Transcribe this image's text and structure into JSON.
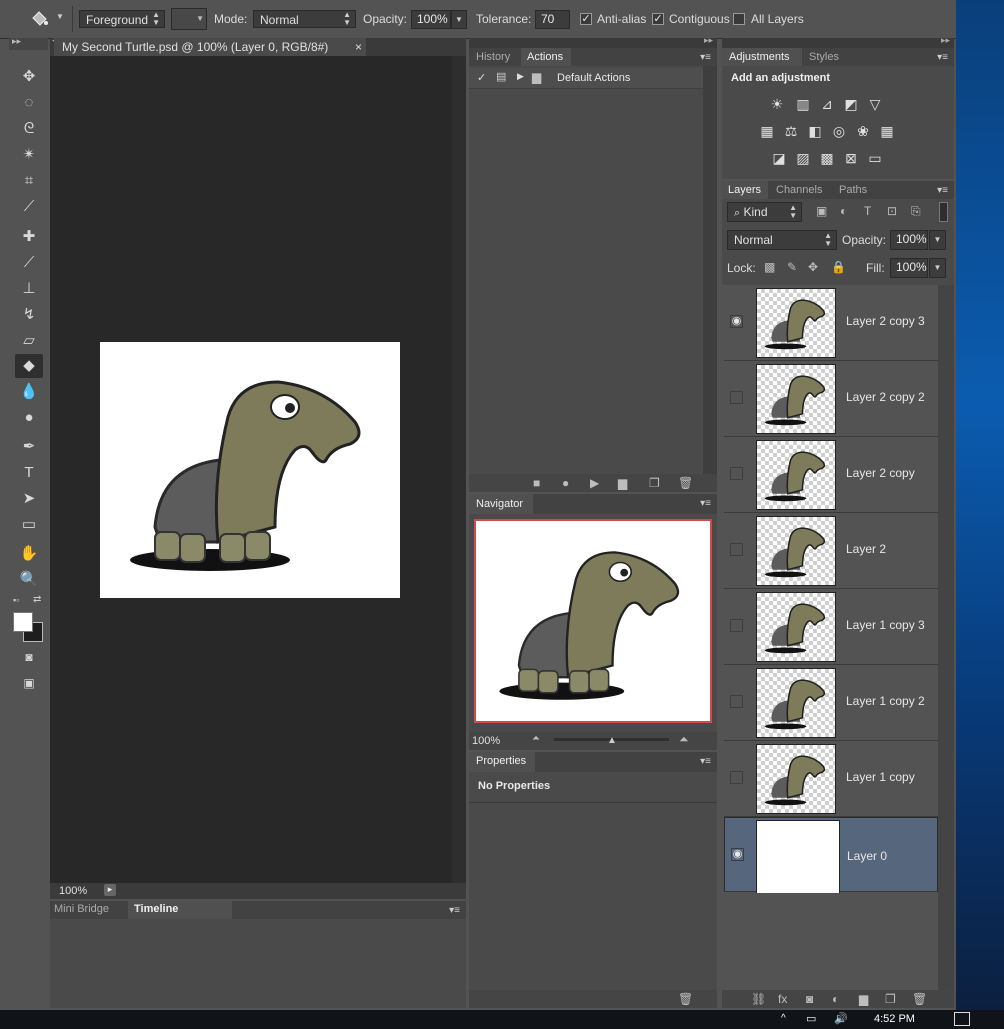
{
  "options_bar": {
    "fill_source": "Foreground",
    "mode_label": "Mode:",
    "mode_value": "Normal",
    "opacity_label": "Opacity:",
    "opacity_value": "100%",
    "tolerance_label": "Tolerance:",
    "tolerance_value": "70",
    "antialias_label": "Anti-alias",
    "antialias_checked": true,
    "contiguous_label": "Contiguous",
    "contiguous_checked": true,
    "all_layers_label": "All Layers",
    "all_layers_checked": false
  },
  "document": {
    "tab_title": "My Second Turtle.psd @ 100% (Layer 0, RGB/8#)",
    "zoom": "100%"
  },
  "bottom_panel": {
    "tabs": [
      "Mini Bridge",
      "Timeline"
    ]
  },
  "actions_panel": {
    "tabs": [
      "History",
      "Actions"
    ],
    "items": [
      {
        "label": "Default Actions"
      }
    ]
  },
  "navigator_panel": {
    "title": "Navigator",
    "zoom": "100%"
  },
  "properties_panel": {
    "title": "Properties",
    "message": "No Properties"
  },
  "adjustments_panel": {
    "tabs": [
      "Adjustments",
      "Styles"
    ],
    "heading": "Add an adjustment"
  },
  "layers_panel": {
    "tabs": [
      "Layers",
      "Channels",
      "Paths"
    ],
    "filter_kind": "Kind",
    "blend_mode": "Normal",
    "opacity_label": "Opacity:",
    "opacity_value": "100%",
    "lock_label": "Lock:",
    "fill_label": "Fill:",
    "fill_value": "100%",
    "layers": [
      {
        "name": "Layer 2 copy 3",
        "visible": true
      },
      {
        "name": "Layer 2 copy 2",
        "visible": false
      },
      {
        "name": "Layer 2 copy",
        "visible": false
      },
      {
        "name": "Layer 2",
        "visible": false
      },
      {
        "name": "Layer 1 copy 3",
        "visible": false
      },
      {
        "name": "Layer 1 copy 2",
        "visible": false
      },
      {
        "name": "Layer 1 copy",
        "visible": false
      },
      {
        "name": "Layer 0",
        "visible": true,
        "selected": true
      }
    ]
  },
  "taskbar": {
    "clock": "4:52 PM"
  }
}
